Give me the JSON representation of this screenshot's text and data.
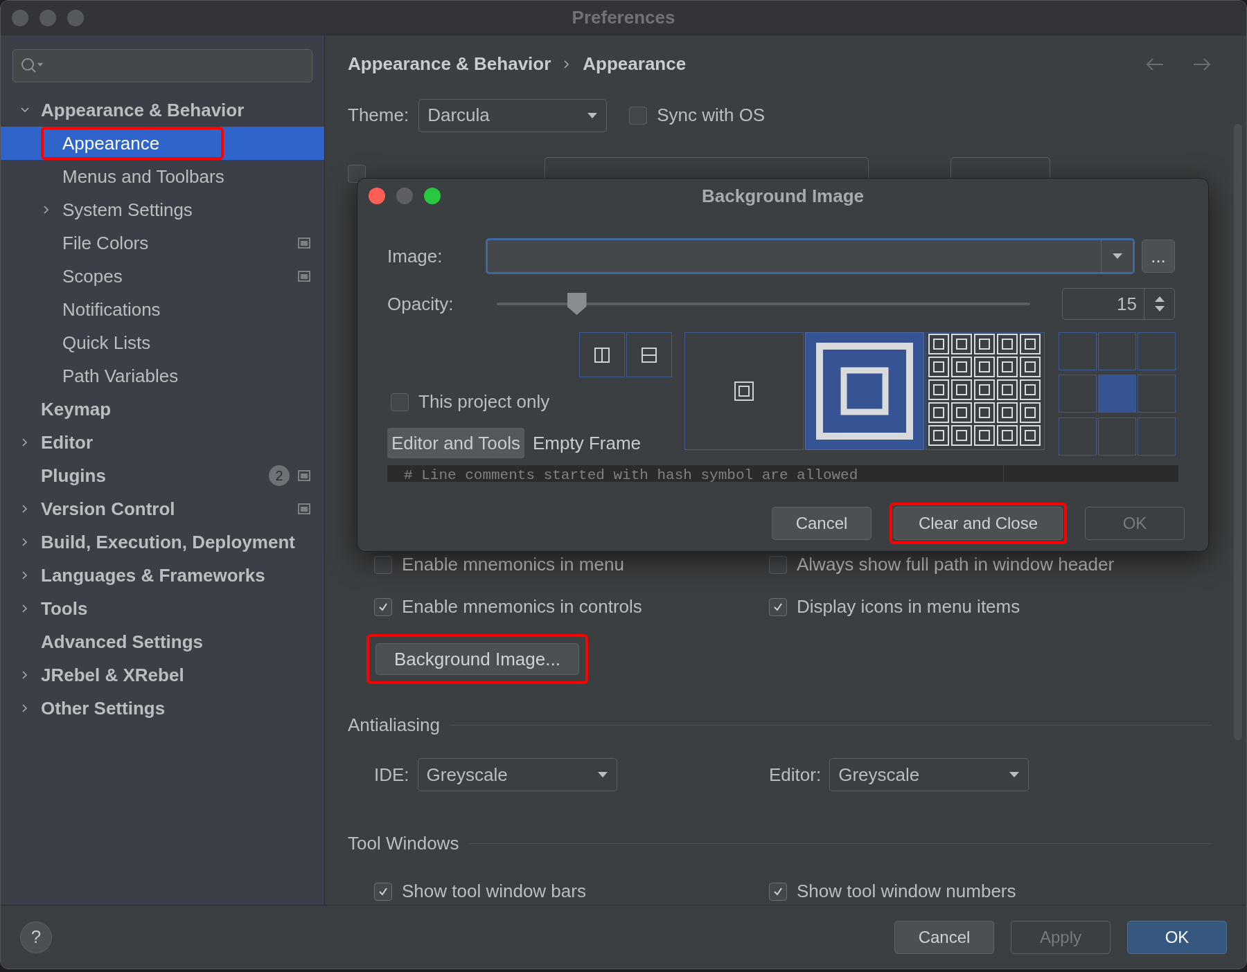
{
  "window": {
    "title": "Preferences"
  },
  "sidebar": {
    "items": [
      {
        "label": "Appearance & Behavior",
        "expanded": true,
        "selected": false,
        "children": [
          {
            "label": "Appearance",
            "selected": true,
            "highlighted": true
          },
          {
            "label": "Menus and Toolbars",
            "selected": false
          },
          {
            "label": "System Settings",
            "expanded": false,
            "selected": false
          },
          {
            "label": "File Colors",
            "selected": false,
            "project_icon": true
          },
          {
            "label": "Scopes",
            "selected": false,
            "project_icon": true
          },
          {
            "label": "Notifications",
            "selected": false
          },
          {
            "label": "Quick Lists",
            "selected": false
          },
          {
            "label": "Path Variables",
            "selected": false
          }
        ]
      },
      {
        "label": "Keymap",
        "selected": false
      },
      {
        "label": "Editor",
        "expanded": false,
        "selected": false
      },
      {
        "label": "Plugins",
        "selected": false,
        "badge": "2",
        "project_icon": true
      },
      {
        "label": "Version Control",
        "expanded": false,
        "selected": false,
        "project_icon": true
      },
      {
        "label": "Build, Execution, Deployment",
        "expanded": false,
        "selected": false
      },
      {
        "label": "Languages & Frameworks",
        "expanded": false,
        "selected": false
      },
      {
        "label": "Tools",
        "expanded": false,
        "selected": false
      },
      {
        "label": "Advanced Settings",
        "selected": false
      },
      {
        "label": "JRebel & XRebel",
        "expanded": false,
        "selected": false
      },
      {
        "label": "Other Settings",
        "expanded": false,
        "selected": false
      }
    ]
  },
  "breadcrumb": [
    "Appearance & Behavior",
    "Appearance"
  ],
  "theme": {
    "label": "Theme:",
    "value": "Darcula"
  },
  "sync_with_os": {
    "label": "Sync with OS",
    "checked": false
  },
  "custom_font": {
    "checked": false
  },
  "options": [
    {
      "label": "Enable mnemonics in menu",
      "checked": false
    },
    {
      "label": "Always show full path in window header",
      "checked": false
    },
    {
      "label": "Enable mnemonics in controls",
      "checked": true
    },
    {
      "label": "Display icons in menu items",
      "checked": true
    }
  ],
  "background_image_button": {
    "label": "Background Image...",
    "highlighted": true
  },
  "antialiasing": {
    "title": "Antialiasing",
    "ide": {
      "label": "IDE:",
      "value": "Greyscale"
    },
    "editor": {
      "label": "Editor:",
      "value": "Greyscale"
    }
  },
  "tool_windows": {
    "title": "Tool Windows",
    "options": [
      {
        "label": "Show tool window bars",
        "checked": true
      },
      {
        "label": "Show tool window numbers",
        "checked": true
      }
    ]
  },
  "footer": {
    "help": "?",
    "buttons": [
      {
        "label": "Cancel",
        "kind": "normal"
      },
      {
        "label": "Apply",
        "kind": "disabled"
      },
      {
        "label": "OK",
        "kind": "primary"
      }
    ]
  },
  "dialog": {
    "title": "Background Image",
    "image": {
      "label": "Image:",
      "browse": "..."
    },
    "opacity": {
      "label": "Opacity:",
      "level": 0.15,
      "value": "15"
    },
    "this_project_only": {
      "label": "This project only",
      "checked": false
    },
    "tabs": [
      {
        "label": "Editor and Tools",
        "selected": true
      },
      {
        "label": "Empty Frame",
        "selected": false
      }
    ],
    "fill_options": [
      {
        "kind": "plain",
        "selected": false
      },
      {
        "kind": "scale",
        "selected": true
      },
      {
        "kind": "tile",
        "selected": false
      }
    ],
    "anchors": [
      {
        "selected": false
      },
      {
        "selected": false
      },
      {
        "selected": false
      },
      {
        "selected": false
      },
      {
        "selected": true
      },
      {
        "selected": false
      },
      {
        "selected": false
      },
      {
        "selected": false
      },
      {
        "selected": false
      }
    ],
    "preview": "# Line comments started with hash symbol are allowed",
    "buttons": [
      {
        "label": "Cancel",
        "kind": "normal",
        "highlighted": false
      },
      {
        "label": "Clear and Close",
        "kind": "normal",
        "highlighted": true
      },
      {
        "label": "OK",
        "kind": "disabled",
        "highlighted": false
      }
    ]
  }
}
